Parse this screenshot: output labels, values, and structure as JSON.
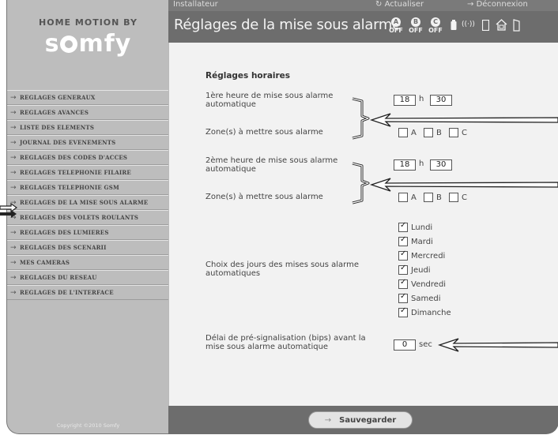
{
  "brand": {
    "top": "HOME MOTION BY",
    "logo": "somfy"
  },
  "topbar": {
    "user": "Installateur",
    "refresh": "Actualiser",
    "logout": "Déconnexion"
  },
  "title": "Réglages de la mise sous alarme",
  "modes": [
    {
      "letter": "A",
      "state": "OFF"
    },
    {
      "letter": "B",
      "state": "OFF"
    },
    {
      "letter": "C",
      "state": "OFF"
    }
  ],
  "status_icons": [
    "battery-icon",
    "radio-signal-icon",
    "sim-card-icon",
    "home-icon",
    "door-icon"
  ],
  "nav": [
    "REGLAGES GENERAUX",
    "REGLAGES AVANCES",
    "LISTE DES ELEMENTS",
    "JOURNAL DES EVENEMENTS",
    "REGLAGES DES CODES D'ACCES",
    "REGLAGES TELEPHONIE FILAIRE",
    "REGLAGES TELEPHONIE GSM",
    "REGLAGES DE LA MISE SOUS ALARME",
    "REGLAGES DES VOLETS ROULANTS",
    "REGLAGES DES LUMIERES",
    "REGLAGES DES SCENARII",
    "MES CAMERAS",
    "REGLAGES DU RESEAU",
    "REGLAGES DE L'INTERFACE"
  ],
  "active_nav_index": 7,
  "copyright": "Copyright ©2010 Somfy",
  "form": {
    "section_title": "Réglages horaires",
    "time1": {
      "label": "1ère heure de mise sous alarme automatique",
      "hour": "18",
      "sep": "h",
      "minute": "30"
    },
    "zones1": {
      "label": "Zone(s) à mettre sous alarme",
      "options": [
        "A",
        "B",
        "C"
      ],
      "checked": [
        false,
        false,
        false
      ]
    },
    "time2": {
      "label": "2ème heure de mise sous alarme automatique",
      "hour": "18",
      "sep": "h",
      "minute": "30"
    },
    "zones2": {
      "label": "Zone(s) à mettre sous alarme",
      "options": [
        "A",
        "B",
        "C"
      ],
      "checked": [
        false,
        false,
        false
      ]
    },
    "days": {
      "label": "Choix des jours des mises sous alarme automatiques",
      "items": [
        "Lundi",
        "Mardi",
        "Mercredi",
        "Jeudi",
        "Vendredi",
        "Samedi",
        "Dimanche"
      ],
      "checked": [
        true,
        true,
        true,
        true,
        true,
        true,
        true
      ]
    },
    "delay": {
      "label": "Délai de pré-signalisation (bips) avant la mise sous alarme automatique",
      "value": "0",
      "unit": "sec"
    }
  },
  "footer": {
    "save_label": "Sauvegarder"
  }
}
